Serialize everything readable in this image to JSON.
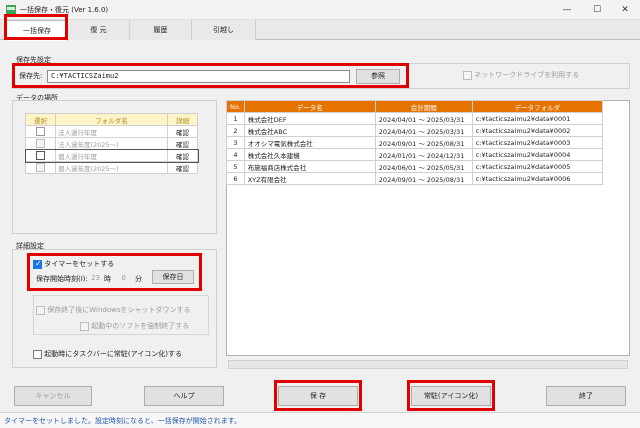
{
  "window": {
    "title": "一括保存・復元 (Ver 1.6.0)",
    "minimize": "—",
    "maximize": "☐",
    "close": "✕"
  },
  "tabs": [
    {
      "label": "一括保存"
    },
    {
      "label": "復 元"
    },
    {
      "label": "履歴"
    },
    {
      "label": "引越し"
    }
  ],
  "save_target": {
    "group_label": "保存先設定",
    "field_label": "保存先:",
    "path_value": "C:¥TACTICSZaimu2",
    "browse_button": "参照",
    "network_drive_label": "ネットワークドライブを利用する"
  },
  "data_location": {
    "group_label": "データの場所",
    "headers": [
      "選択",
      "フォルダ名",
      "詳細"
    ],
    "rows": [
      {
        "checked": true,
        "name": "法人運行年度",
        "detail": "確認",
        "enabled": false
      },
      {
        "checked": false,
        "name": "法人過年度(2025〜)",
        "detail": "確認",
        "enabled": false
      },
      {
        "checked": true,
        "name": "個人運行年度",
        "detail": "確認",
        "enabled": true
      },
      {
        "checked": false,
        "name": "個人過年度(2025〜)",
        "detail": "確認",
        "enabled": false
      }
    ]
  },
  "data_table": {
    "headers": [
      "No.",
      "データ名",
      "会計期間",
      "データフォルダ"
    ],
    "rows": [
      [
        "1",
        "株式会社DEF",
        "2024/04/01 〜 2025/03/31",
        "c:¥tacticszaimu2¥data¥0001"
      ],
      [
        "2",
        "株式会社ABC",
        "2024/04/01 〜 2025/03/31",
        "c:¥tacticszaimu2¥data¥0002"
      ],
      [
        "3",
        "オオシマ電気株式会社",
        "2024/09/01 〜 2025/08/31",
        "c:¥tacticszaimu2¥data¥0003"
      ],
      [
        "4",
        "株式会社久本建機",
        "2024/01/01 〜 2024/12/31",
        "c:¥tacticszaimu2¥data¥0004"
      ],
      [
        "5",
        "布施福商店株式会社",
        "2024/06/01 〜 2025/05/31",
        "c:¥tacticszaimu2¥data¥0005"
      ],
      [
        "6",
        "XYZ有限会社",
        "2024/09/01 〜 2025/08/31",
        "c:¥tacticszaimu2¥data¥0006"
      ]
    ]
  },
  "detail_settings": {
    "group_label": "詳細設定",
    "timer_label": "タイマーをセットする",
    "timer_checked": true,
    "start_time_label": "保存開始時刻(I):",
    "hour_value": "23",
    "hour_unit": "時",
    "minute_value": "0",
    "minute_unit": "分",
    "save_day_button": "保存日",
    "shutdown_label": "保存終了後にWindowsをシャットダウンする",
    "force_quit_label": "起動中のソフトを強制終了する",
    "taskbar_label": "起動時にタスクバーに常駐(アイコン化)する"
  },
  "footer": {
    "cancel": "キャンセル",
    "help": "ヘルプ",
    "save": "保 存",
    "resident": "常駐(アイコン化)",
    "exit": "終了"
  },
  "status": {
    "text": "タイマーをセットしました。設定時刻になると、一括保存が開始されます。"
  },
  "colors": {
    "highlight": "#e00000",
    "header_orange": "#e67300",
    "accent_blue": "#1a73e8"
  }
}
